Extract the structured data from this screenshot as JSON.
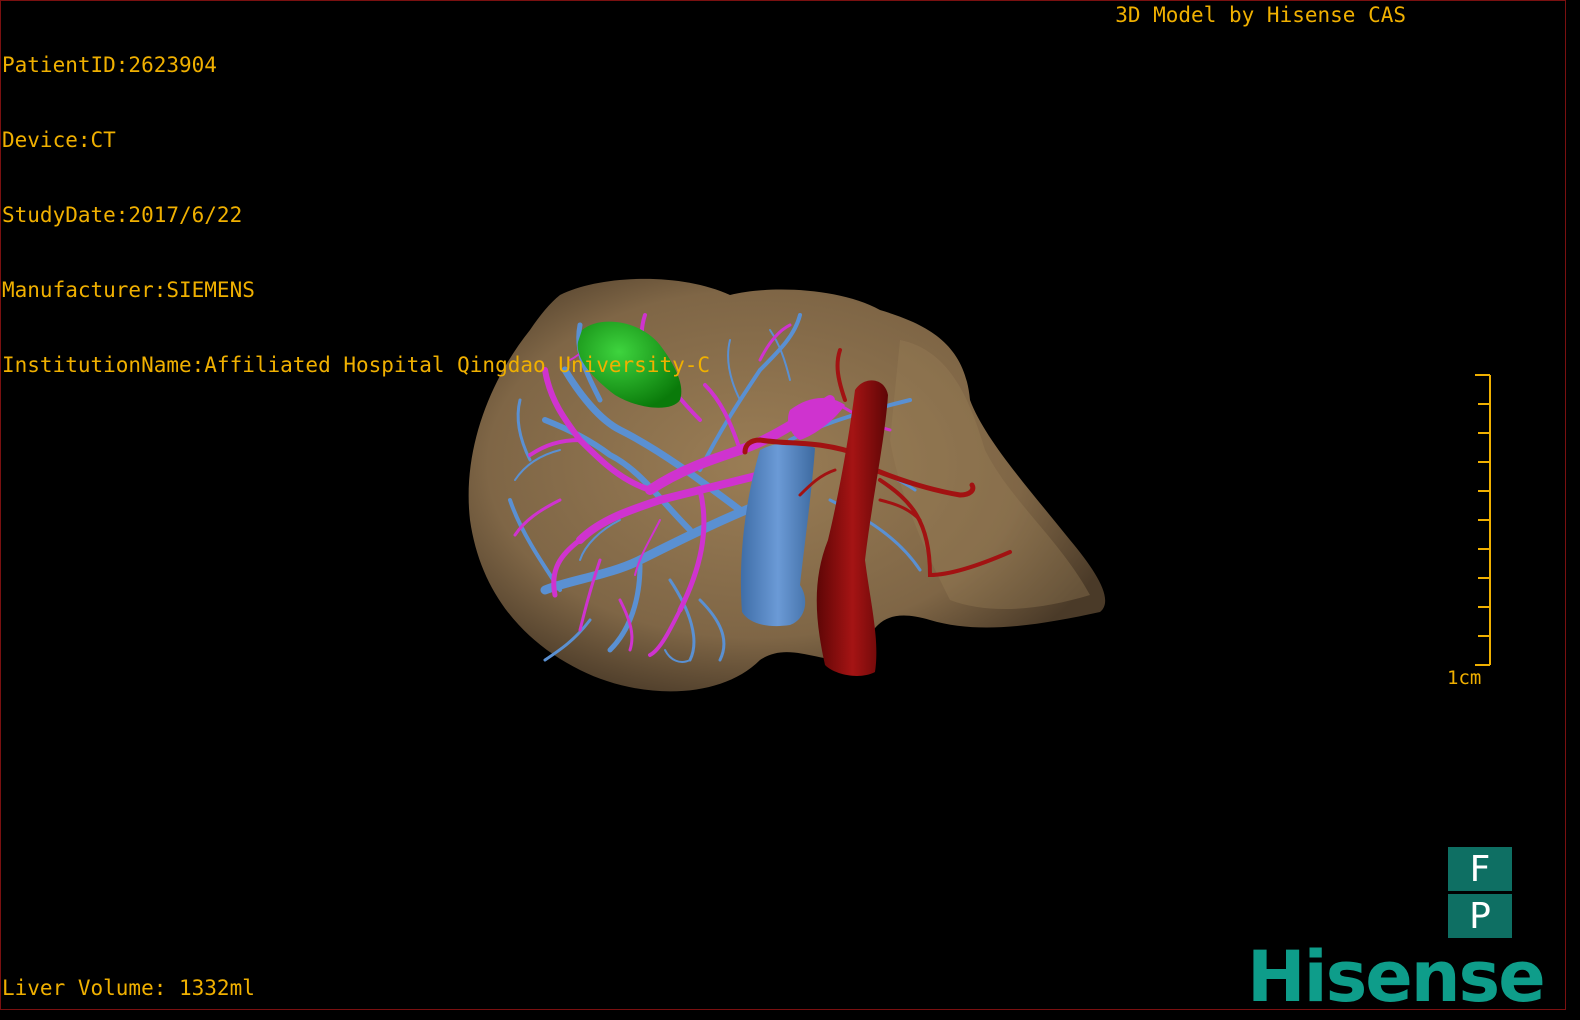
{
  "header": {
    "patient_id": "PatientID:2623904",
    "device": "Device:CT",
    "study_date": "StudyDate:2017/6/22",
    "manufacturer": "Manufacturer:SIEMENS",
    "institution": "InstitutionName:Affiliated Hospital Qingdao University-C",
    "brand_text": "3D Model by Hisense CAS"
  },
  "footer": {
    "liver_volume": "Liver Volume: 1332ml"
  },
  "scale": {
    "label": "1cm"
  },
  "orientation": {
    "top_letter": "F",
    "bottom_letter": "P"
  },
  "logo": {
    "text": "Hisense"
  },
  "colors": {
    "overlay_text": "#f0b000",
    "liver": "#8a6f4c",
    "portal_vein": "#cc33cc",
    "hepatic_vein": "#5a8fd0",
    "artery": "#9b1010",
    "gallbladder": "#1aa31a",
    "logo": "#0e9d8a"
  }
}
